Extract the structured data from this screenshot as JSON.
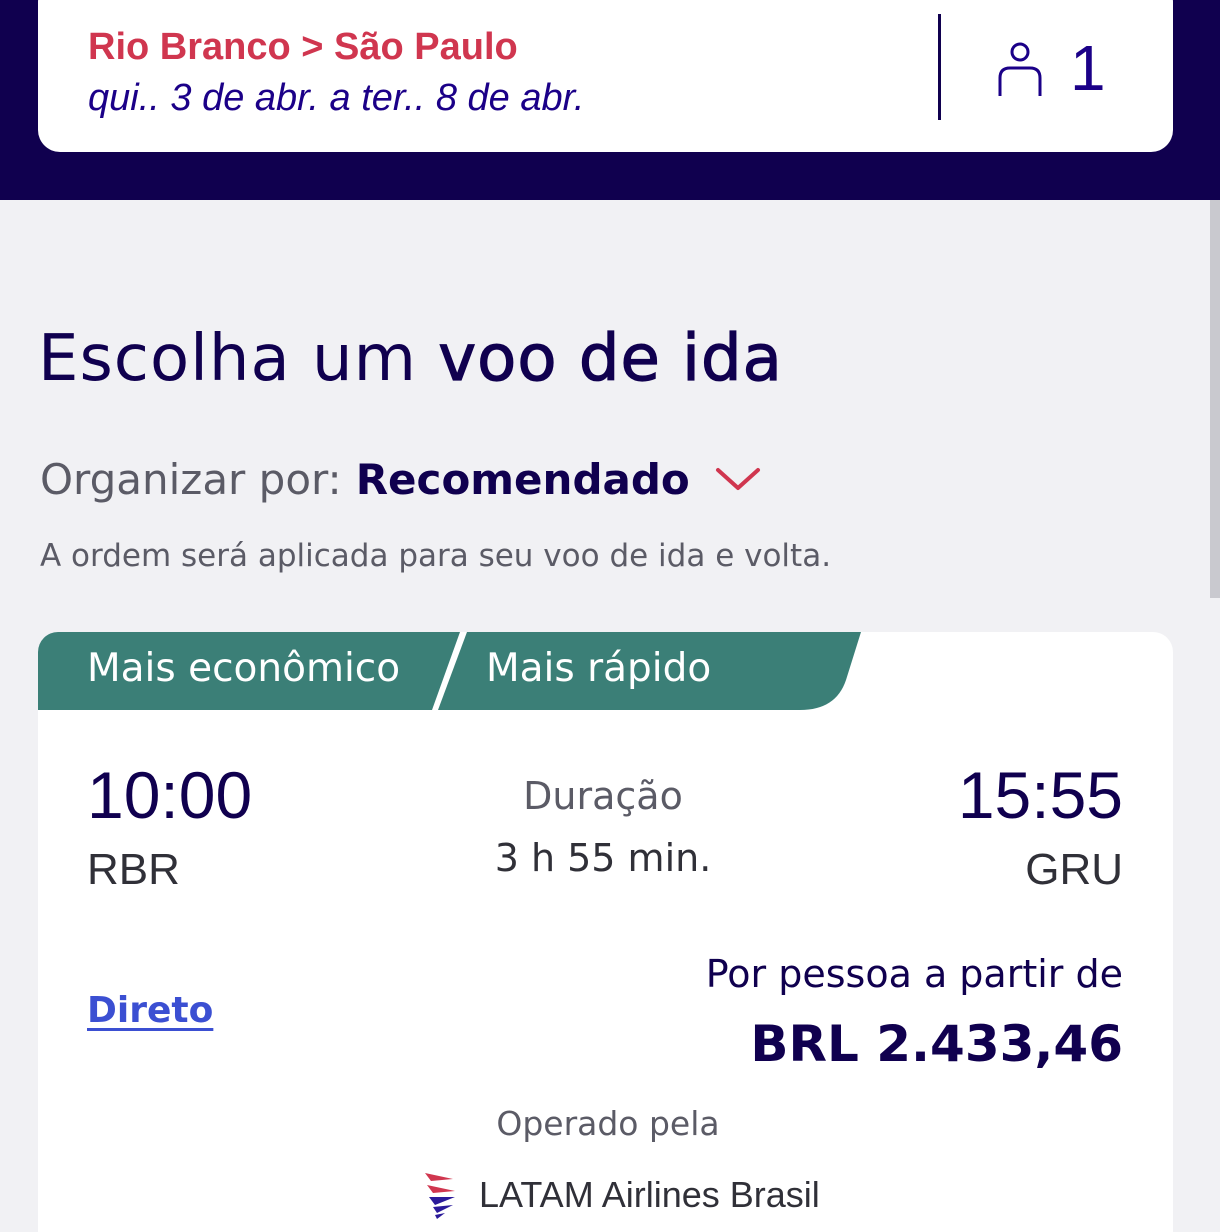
{
  "search": {
    "route": "Rio Branco > São Paulo",
    "dates": "qui.. 3 de abr. a ter.. 8 de abr.",
    "passengers": "1",
    "passenger_icon": "person-icon"
  },
  "page": {
    "title_light": "Escolha um ",
    "title_strong": "voo de ida"
  },
  "sort": {
    "label": "Organizar por:",
    "value": "Recomendado",
    "note": "A ordem será aplicada para seu voo de ida e volta."
  },
  "flight": {
    "badges": [
      "Mais econômico",
      "Mais rápido"
    ],
    "departure_time": "10:00",
    "departure_airport": "RBR",
    "duration_label": "Duração",
    "duration_value": "3 h 55 min.",
    "arrival_time": "15:55",
    "arrival_airport": "GRU",
    "stops": "Direto",
    "price_label": "Por pessoa a partir de",
    "price": "BRL 2.433,46",
    "operated_label": "Operado pela",
    "operator": "LATAM Airlines Brasil"
  },
  "colors": {
    "brand_navy": "#10004f",
    "accent_red": "#d0364f",
    "badge_teal": "#3b7f77",
    "link_blue": "#3b4fd2"
  }
}
